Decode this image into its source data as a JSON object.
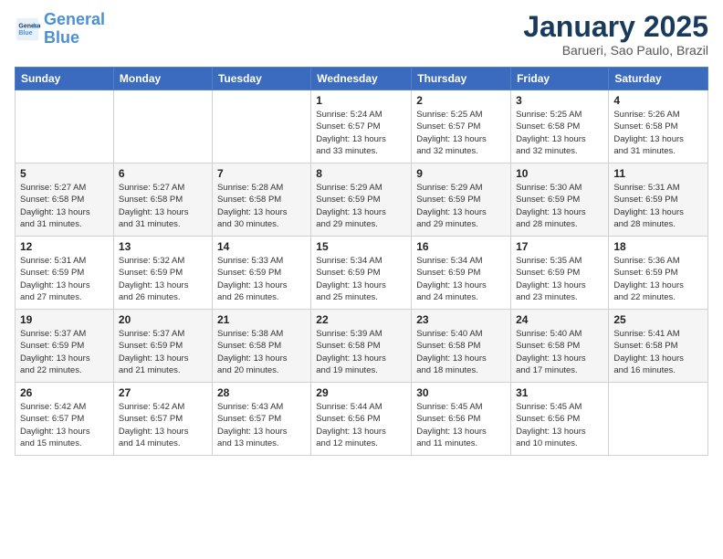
{
  "logo": {
    "line1": "General",
    "line2": "Blue"
  },
  "title": "January 2025",
  "subtitle": "Barueri, Sao Paulo, Brazil",
  "weekdays": [
    "Sunday",
    "Monday",
    "Tuesday",
    "Wednesday",
    "Thursday",
    "Friday",
    "Saturday"
  ],
  "weeks": [
    [
      {
        "day": "",
        "info": ""
      },
      {
        "day": "",
        "info": ""
      },
      {
        "day": "",
        "info": ""
      },
      {
        "day": "1",
        "info": "Sunrise: 5:24 AM\nSunset: 6:57 PM\nDaylight: 13 hours\nand 33 minutes."
      },
      {
        "day": "2",
        "info": "Sunrise: 5:25 AM\nSunset: 6:57 PM\nDaylight: 13 hours\nand 32 minutes."
      },
      {
        "day": "3",
        "info": "Sunrise: 5:25 AM\nSunset: 6:58 PM\nDaylight: 13 hours\nand 32 minutes."
      },
      {
        "day": "4",
        "info": "Sunrise: 5:26 AM\nSunset: 6:58 PM\nDaylight: 13 hours\nand 31 minutes."
      }
    ],
    [
      {
        "day": "5",
        "info": "Sunrise: 5:27 AM\nSunset: 6:58 PM\nDaylight: 13 hours\nand 31 minutes."
      },
      {
        "day": "6",
        "info": "Sunrise: 5:27 AM\nSunset: 6:58 PM\nDaylight: 13 hours\nand 31 minutes."
      },
      {
        "day": "7",
        "info": "Sunrise: 5:28 AM\nSunset: 6:58 PM\nDaylight: 13 hours\nand 30 minutes."
      },
      {
        "day": "8",
        "info": "Sunrise: 5:29 AM\nSunset: 6:59 PM\nDaylight: 13 hours\nand 29 minutes."
      },
      {
        "day": "9",
        "info": "Sunrise: 5:29 AM\nSunset: 6:59 PM\nDaylight: 13 hours\nand 29 minutes."
      },
      {
        "day": "10",
        "info": "Sunrise: 5:30 AM\nSunset: 6:59 PM\nDaylight: 13 hours\nand 28 minutes."
      },
      {
        "day": "11",
        "info": "Sunrise: 5:31 AM\nSunset: 6:59 PM\nDaylight: 13 hours\nand 28 minutes."
      }
    ],
    [
      {
        "day": "12",
        "info": "Sunrise: 5:31 AM\nSunset: 6:59 PM\nDaylight: 13 hours\nand 27 minutes."
      },
      {
        "day": "13",
        "info": "Sunrise: 5:32 AM\nSunset: 6:59 PM\nDaylight: 13 hours\nand 26 minutes."
      },
      {
        "day": "14",
        "info": "Sunrise: 5:33 AM\nSunset: 6:59 PM\nDaylight: 13 hours\nand 26 minutes."
      },
      {
        "day": "15",
        "info": "Sunrise: 5:34 AM\nSunset: 6:59 PM\nDaylight: 13 hours\nand 25 minutes."
      },
      {
        "day": "16",
        "info": "Sunrise: 5:34 AM\nSunset: 6:59 PM\nDaylight: 13 hours\nand 24 minutes."
      },
      {
        "day": "17",
        "info": "Sunrise: 5:35 AM\nSunset: 6:59 PM\nDaylight: 13 hours\nand 23 minutes."
      },
      {
        "day": "18",
        "info": "Sunrise: 5:36 AM\nSunset: 6:59 PM\nDaylight: 13 hours\nand 22 minutes."
      }
    ],
    [
      {
        "day": "19",
        "info": "Sunrise: 5:37 AM\nSunset: 6:59 PM\nDaylight: 13 hours\nand 22 minutes."
      },
      {
        "day": "20",
        "info": "Sunrise: 5:37 AM\nSunset: 6:59 PM\nDaylight: 13 hours\nand 21 minutes."
      },
      {
        "day": "21",
        "info": "Sunrise: 5:38 AM\nSunset: 6:58 PM\nDaylight: 13 hours\nand 20 minutes."
      },
      {
        "day": "22",
        "info": "Sunrise: 5:39 AM\nSunset: 6:58 PM\nDaylight: 13 hours\nand 19 minutes."
      },
      {
        "day": "23",
        "info": "Sunrise: 5:40 AM\nSunset: 6:58 PM\nDaylight: 13 hours\nand 18 minutes."
      },
      {
        "day": "24",
        "info": "Sunrise: 5:40 AM\nSunset: 6:58 PM\nDaylight: 13 hours\nand 17 minutes."
      },
      {
        "day": "25",
        "info": "Sunrise: 5:41 AM\nSunset: 6:58 PM\nDaylight: 13 hours\nand 16 minutes."
      }
    ],
    [
      {
        "day": "26",
        "info": "Sunrise: 5:42 AM\nSunset: 6:57 PM\nDaylight: 13 hours\nand 15 minutes."
      },
      {
        "day": "27",
        "info": "Sunrise: 5:42 AM\nSunset: 6:57 PM\nDaylight: 13 hours\nand 14 minutes."
      },
      {
        "day": "28",
        "info": "Sunrise: 5:43 AM\nSunset: 6:57 PM\nDaylight: 13 hours\nand 13 minutes."
      },
      {
        "day": "29",
        "info": "Sunrise: 5:44 AM\nSunset: 6:56 PM\nDaylight: 13 hours\nand 12 minutes."
      },
      {
        "day": "30",
        "info": "Sunrise: 5:45 AM\nSunset: 6:56 PM\nDaylight: 13 hours\nand 11 minutes."
      },
      {
        "day": "31",
        "info": "Sunrise: 5:45 AM\nSunset: 6:56 PM\nDaylight: 13 hours\nand 10 minutes."
      },
      {
        "day": "",
        "info": ""
      }
    ]
  ]
}
